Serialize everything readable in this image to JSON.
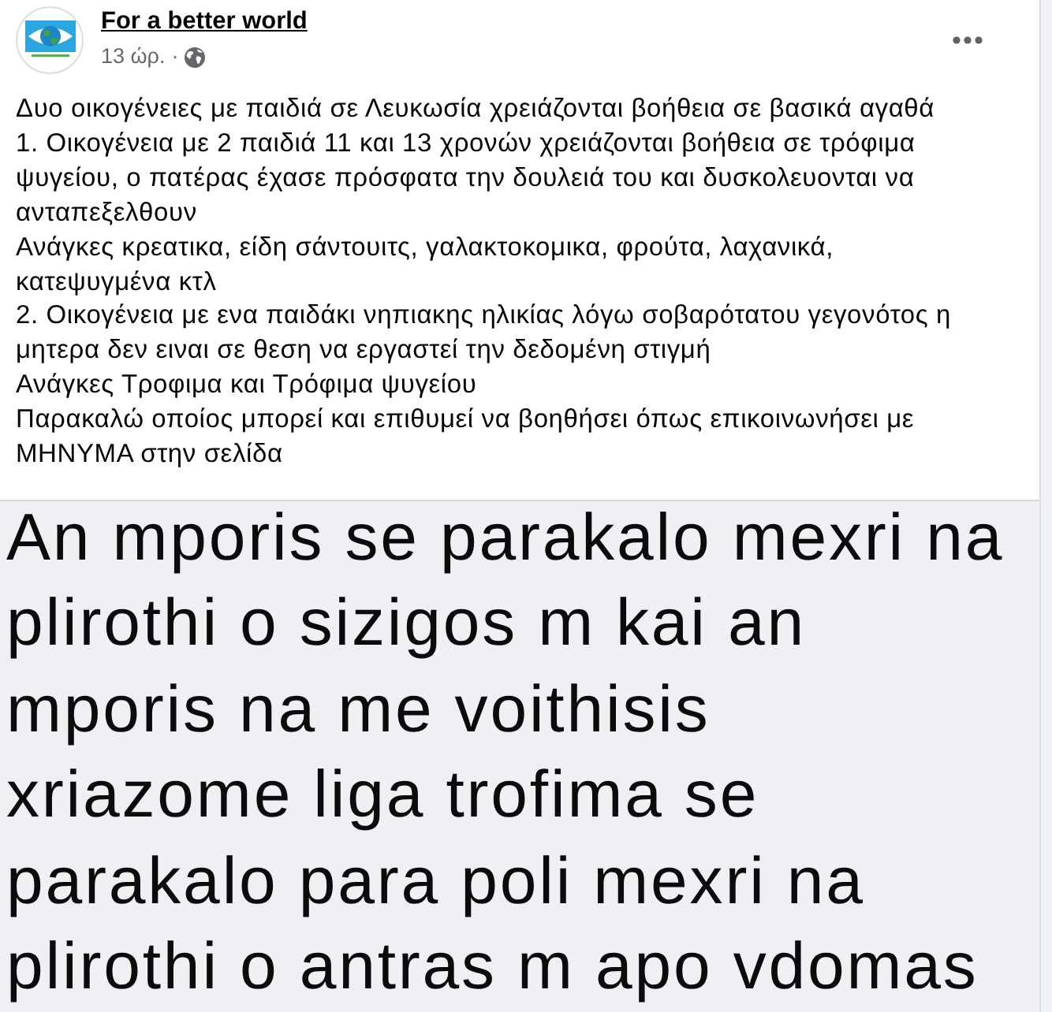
{
  "post": {
    "author": "For a better world",
    "time": "13 ώρ.",
    "separator": "·",
    "paragraphs": [
      "Δυο οικογένειες με παιδιά σε Λευκωσία χρειάζονται βοήθεια σε βασικά αγαθά",
      "1. Οικογένεια με 2 παιδιά 11 και 13 χρονών χρειάζονται βοήθεια σε τρόφιμα ψυγείου, ο πατέρας έχασε πρόσφατα την δουλειά του και δυσκολευονται να ανταπεξελθουν",
      "Ανάγκες κρεατικα, είδη σάντουιτς, γαλακτοκομικα, φρούτα, λαχανικά, κατεψυγμένα κτλ",
      "2. Οικογένεια με ενα παιδάκι νηπιακης ηλικίας λόγω σοβαρότατου γεγονότος η μητερα δεν ειναι σε θεση να εργαστεί την δεδομένη στιγμή",
      "Ανάγκες Τροφιμα και Τρόφιμα ψυγείου",
      "Παρακαλώ οποίος μπορεί και επιθυμεί να βοηθήσει όπως επικοινωνήσει με ΜΗΝΥΜΑ στην σελίδα"
    ],
    "image": {
      "text": "An mporis se parakalo mexri na\nplirothi o sizigos m kai an\nmporis na me voithisis\nxriazome liga trofima se\nparakalo para poli mexri na\nplirothi o antras m apo vdomas"
    }
  }
}
